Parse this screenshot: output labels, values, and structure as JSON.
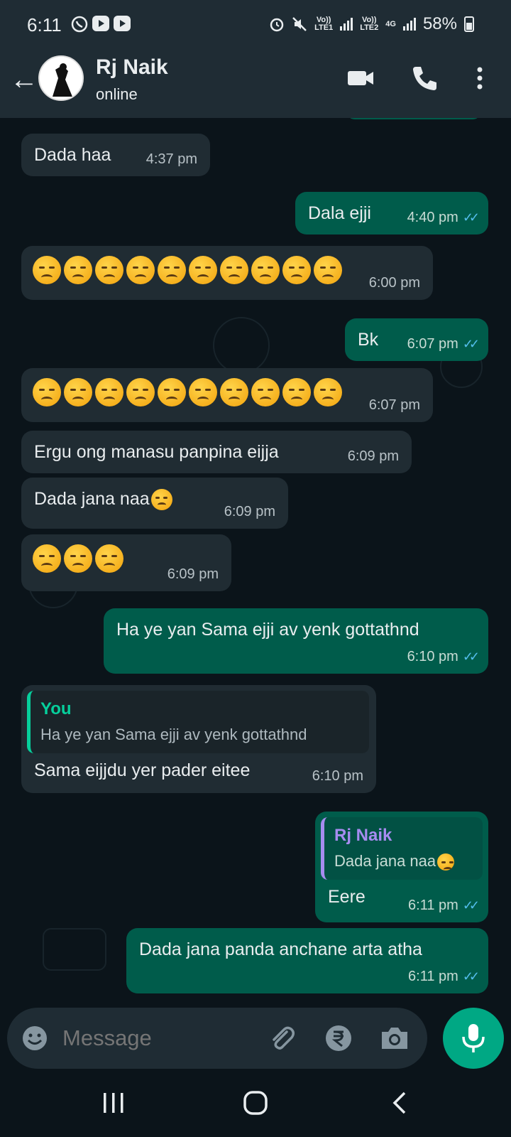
{
  "status_bar": {
    "time": "6:11",
    "net1_line1": "Vo))",
    "net1_line2": "LTE1",
    "net2_line1": "Vo))",
    "net2_line2": "LTE2",
    "net_type": "4G",
    "battery": "58%",
    "icons": [
      "whatsapp-icon",
      "youtube-icon",
      "youtube-icon",
      "alarm-icon",
      "mute-icon",
      "signal-icon",
      "battery-icon"
    ]
  },
  "header": {
    "contact_name": "Rj Naik",
    "contact_status": "online",
    "icons": [
      "back-arrow-icon",
      "video-call-icon",
      "phone-icon",
      "more-vert-icon"
    ]
  },
  "messages": [
    {
      "dir": "in",
      "text": "Dada haa",
      "time": "4:37 pm"
    },
    {
      "dir": "out",
      "text": "Dala ejji",
      "time": "4:40 pm",
      "read": true
    },
    {
      "dir": "in",
      "emoji": "disappointed-face",
      "emoji_count": 10,
      "time": "6:00 pm"
    },
    {
      "dir": "out",
      "text": "Bk",
      "time": "6:07 pm",
      "read": true
    },
    {
      "dir": "in",
      "emoji": "disappointed-face",
      "emoji_count": 10,
      "time": "6:07 pm"
    },
    {
      "dir": "in",
      "text": "Ergu ong manasu panpina eijja",
      "time": "6:09 pm"
    },
    {
      "dir": "in",
      "text": "Dada jana naa",
      "trailing_emoji": "thinking-face",
      "time": "6:09 pm"
    },
    {
      "dir": "in",
      "emoji": "disappointed-face",
      "emoji_count": 3,
      "time": "6:09 pm"
    },
    {
      "dir": "out",
      "text": "Ha ye yan Sama ejji av yenk gottathnd",
      "time": "6:10 pm",
      "read": true
    },
    {
      "dir": "in",
      "quote_name": "You",
      "quote_text": "Ha ye yan Sama ejji av yenk gottathnd",
      "text": "Sama eijjdu yer pader eitee",
      "time": "6:10 pm"
    },
    {
      "dir": "out",
      "quote_name": "Rj Naik",
      "quote_text": "Dada jana naa",
      "quote_emoji": "thinking-face",
      "text": "Eere",
      "time": "6:11 pm",
      "read": true
    },
    {
      "dir": "out",
      "text": "Dada jana panda anchane arta atha",
      "time": "6:11 pm",
      "read": true
    }
  ],
  "input": {
    "placeholder": "Message",
    "icons": [
      "emoji-icon",
      "attach-icon",
      "rupee-payment-icon",
      "camera-icon",
      "mic-icon"
    ]
  },
  "colors": {
    "background": "#0b141a",
    "header": "#1f2c34",
    "incoming_bubble": "#202c33",
    "outgoing_bubble": "#005c4b",
    "read_ticks": "#53bdeb",
    "accent": "#00a884"
  }
}
